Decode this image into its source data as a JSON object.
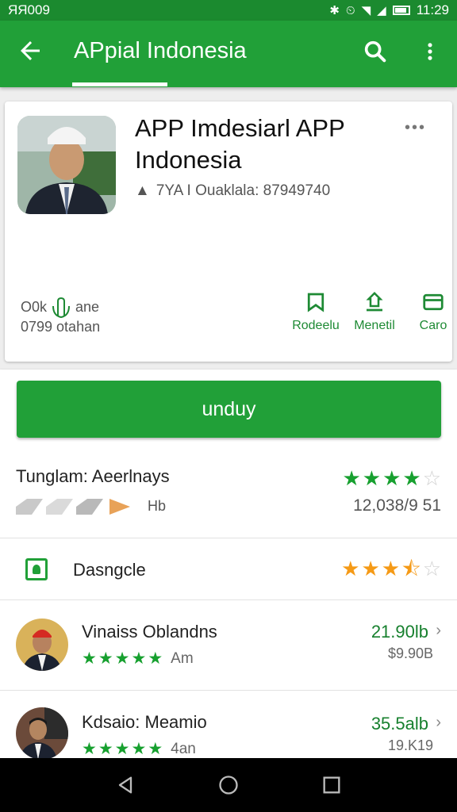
{
  "status_bar": {
    "time_left": "ЯЯ009",
    "time_right": "11:29"
  },
  "app_bar": {
    "title": "APpial Indonesia"
  },
  "app": {
    "title": "APP Imdesiarl APP Indonesia",
    "meta": "7YA I Ouaklala: 87949740",
    "stat_top_left": "O0k",
    "stat_top_right": "ane",
    "stat_bottom": "0799 otahan",
    "more_label": "•••",
    "actions": [
      {
        "label": "Rodeelu",
        "icon": "bookmark-icon"
      },
      {
        "label": "Menetil",
        "icon": "share-icon"
      },
      {
        "label": "Caro",
        "icon": "wallet-icon"
      }
    ]
  },
  "install": {
    "label": "unduy"
  },
  "rating": {
    "heading": "Tunglam: Aeerlnays",
    "stars_filled": 4,
    "stars_total": 5,
    "chip_tail": "Hb",
    "count": "12,038/9 51"
  },
  "row": {
    "label": "Dasngcle",
    "stars_filled": 3.5,
    "stars_total": 5
  },
  "reviews": [
    {
      "name": "Vinaiss Oblandns",
      "stars": 5,
      "time": "Am",
      "size": "21.90lb",
      "price": "$9.90B"
    },
    {
      "name": "Kdsaio: Meamio",
      "stars": 5,
      "time": "4an",
      "size": "35.5alb",
      "price": "19.K19"
    }
  ],
  "colors": {
    "primary": "#21a038",
    "status_bar": "#1b8a2f",
    "star_green": "#17a02f",
    "star_orange": "#f59a16"
  }
}
